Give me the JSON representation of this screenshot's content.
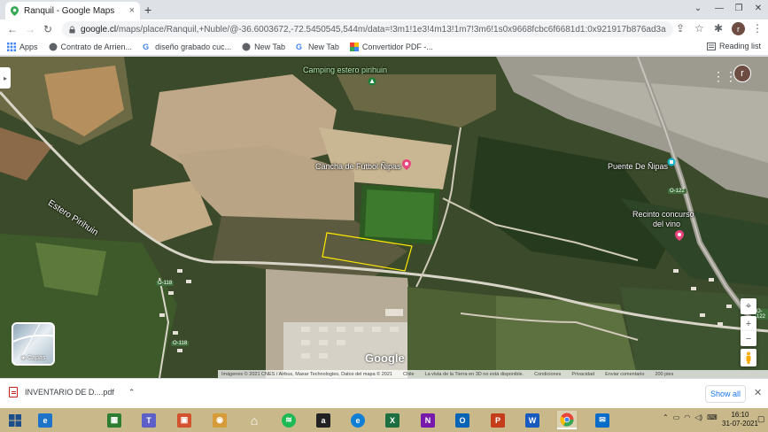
{
  "browser": {
    "tab_title": "Ranquil - Google Maps",
    "tab_close": "×",
    "new_tab": "+",
    "url_host": "google.cl",
    "url_rest": "/maps/place/Ranquil,+Ñuble/@-36.6003672,-72.5450545,544m/data=!3m1!1e3!4m13!1m7!3m6!1s0x9668fcbc6f6681d1:0x921917b876ad3a91!2sNipas,+Ranq...",
    "window_controls": [
      "⌄",
      "—",
      "❐",
      "✕"
    ]
  },
  "bookmarks": {
    "items": [
      {
        "label": "Apps",
        "icon": "apps-grid-icon"
      },
      {
        "label": "Contrato de Arrien...",
        "icon": "globe-icon"
      },
      {
        "label": "diseño grabado cuc...",
        "icon": "google-icon"
      },
      {
        "label": "New Tab",
        "icon": "globe-icon"
      },
      {
        "label": "New Tab",
        "icon": "google-icon"
      },
      {
        "label": "Convertidor PDF -...",
        "icon": "colored-square-icon"
      }
    ],
    "reading_list": "Reading list"
  },
  "map": {
    "labels": {
      "camping": "Camping estero pirihuin",
      "cancha": "Cancha de Fútbol Ñipas",
      "puente": "Puente De Ñipas",
      "recinto_1": "Recinto concurso",
      "recinto_2": "del vino",
      "estero": "Estero Pirihuin"
    },
    "road_labels": {
      "n122_a": "O-122",
      "n118_a": "O-118",
      "n118_b": "O-118",
      "n122_b": "O-122"
    },
    "layers_label": "Capas",
    "google_logo": "Google",
    "account_initial": "r",
    "attribution": [
      "Imágenes © 2021 CNES / Airbus, Maxar Technologies, Datos del mapa © 2021",
      "Chile",
      "La vista de la Tierra en 3D no está disponible.",
      "Condiciones",
      "Privacidad",
      "Enviar comentario",
      "200 pies"
    ]
  },
  "downloads": {
    "file_name": "INVENTARIO DE D....pdf",
    "show_all": "Show all"
  },
  "taskbar": {
    "clock_time": "16:10",
    "clock_date": "31-07-2021",
    "apps": [
      {
        "name": "windows-start",
        "color": "#ffffff"
      },
      {
        "name": "edge-legacy",
        "color": "#1e73c8"
      },
      {
        "name": "excel-store",
        "color": "#2e7d32"
      },
      {
        "name": "teams",
        "color": "#5b5fc7"
      },
      {
        "name": "powerpoint-store",
        "color": "#d35230"
      },
      {
        "name": "app-orange",
        "color": "#d89b3a"
      },
      {
        "name": "home",
        "color": "#ffffff"
      },
      {
        "name": "spotify",
        "color": "#1db954"
      },
      {
        "name": "amazon",
        "color": "#222222"
      },
      {
        "name": "edge",
        "color": "#0f7fd6"
      },
      {
        "name": "excel",
        "color": "#1d6f42"
      },
      {
        "name": "onenote",
        "color": "#7719aa"
      },
      {
        "name": "outlook",
        "color": "#0a64b5"
      },
      {
        "name": "powerpoint",
        "color": "#c43e1c"
      },
      {
        "name": "word",
        "color": "#185abd"
      },
      {
        "name": "chrome",
        "color": "#e8453c"
      },
      {
        "name": "mail",
        "color": "#0a6cc9"
      }
    ]
  }
}
